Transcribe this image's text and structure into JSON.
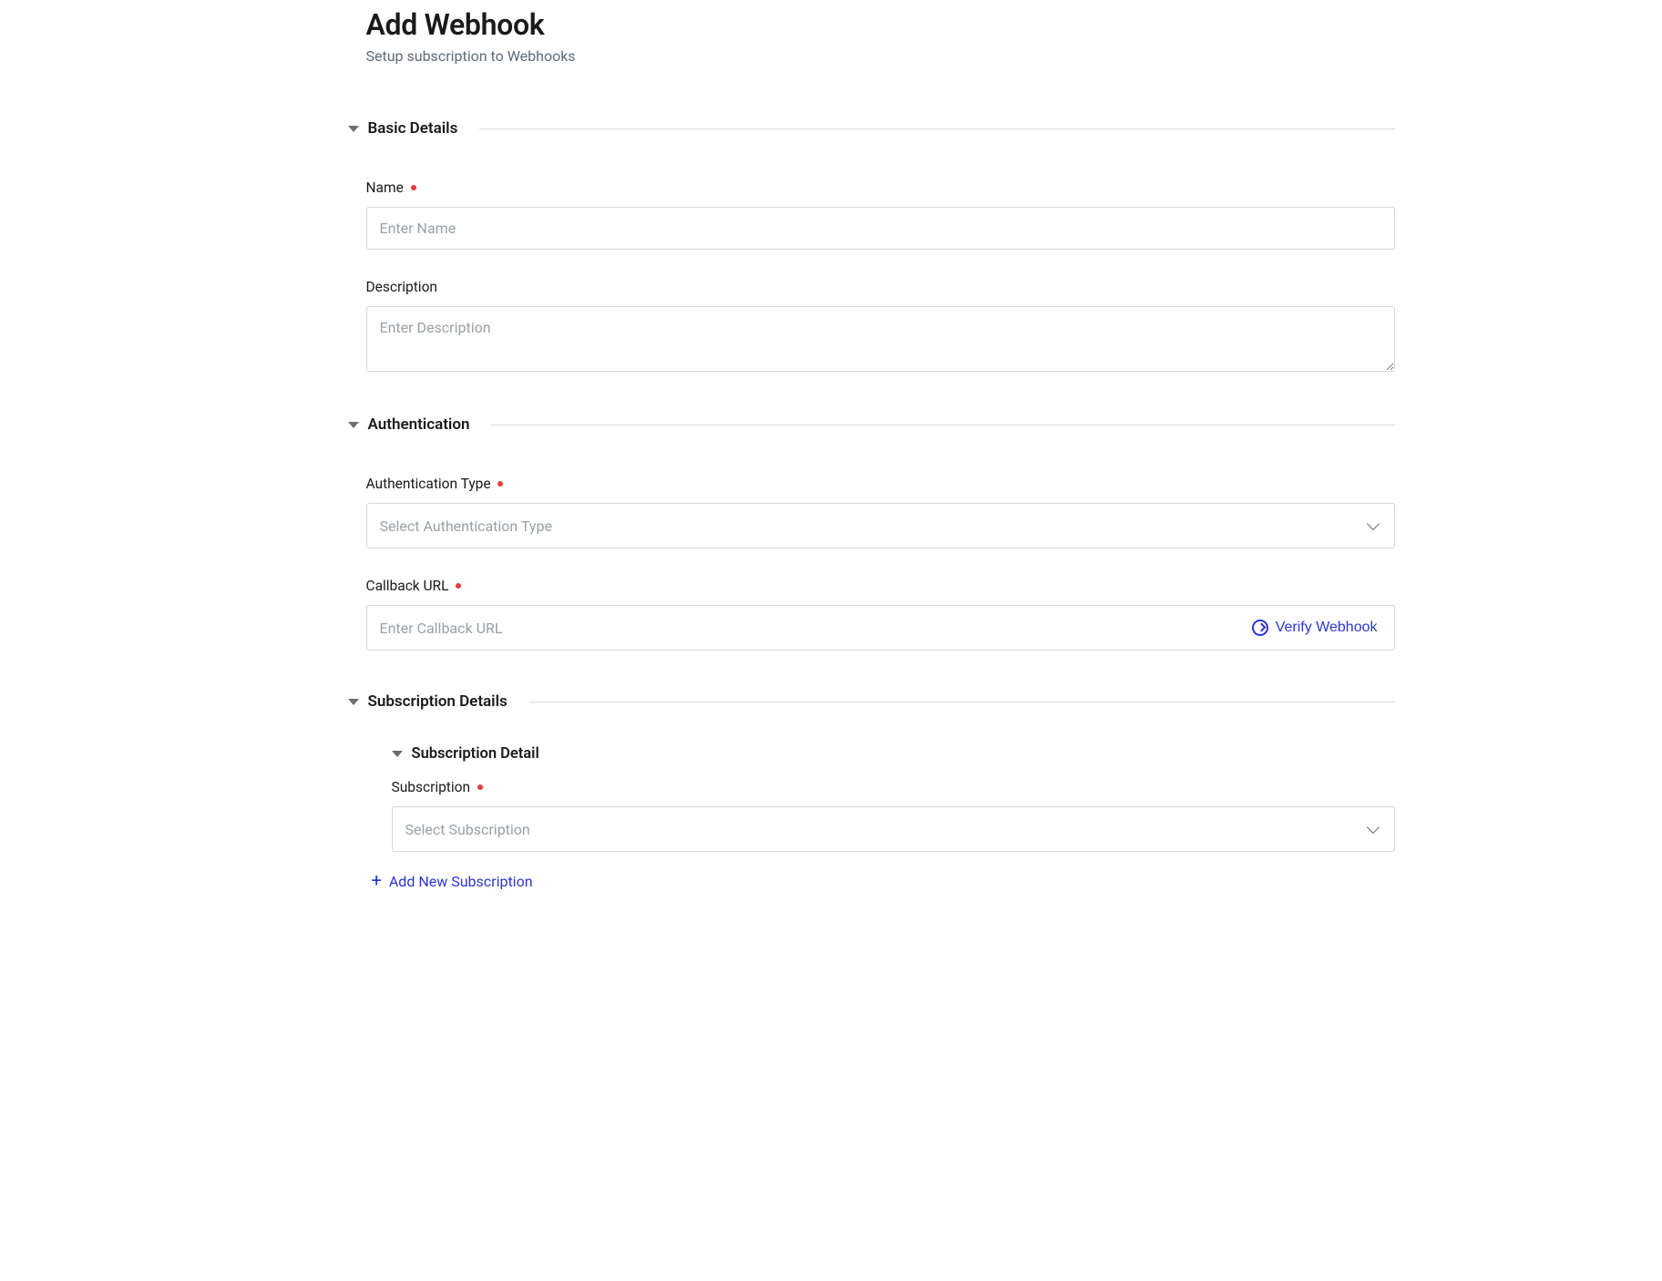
{
  "header": {
    "title": "Add Webhook",
    "subtitle": "Setup subscription to Webhooks"
  },
  "sections": {
    "basic": {
      "title": "Basic Details",
      "fields": {
        "name": {
          "label": "Name",
          "placeholder": "Enter Name",
          "required": true,
          "value": ""
        },
        "description": {
          "label": "Description",
          "placeholder": "Enter Description",
          "required": false,
          "value": ""
        }
      }
    },
    "auth": {
      "title": "Authentication",
      "fields": {
        "auth_type": {
          "label": "Authentication Type",
          "placeholder": "Select Authentication Type",
          "required": true,
          "value": ""
        },
        "callback": {
          "label": "Callback URL",
          "placeholder": "Enter Callback URL",
          "required": true,
          "value": ""
        },
        "verify_label": "Verify Webhook"
      }
    },
    "subscription": {
      "title": "Subscription Details",
      "detail": {
        "title": "Subscription Detail",
        "field": {
          "label": "Subscription",
          "placeholder": "Select Subscription",
          "required": true,
          "value": ""
        },
        "add_label": "Add New Subscription"
      }
    }
  }
}
